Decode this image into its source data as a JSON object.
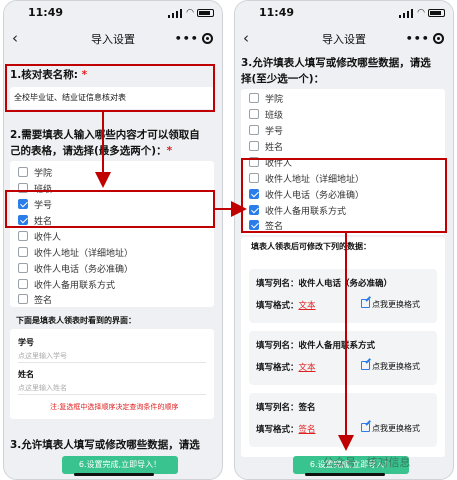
{
  "status": {
    "time": "11:49"
  },
  "nav": {
    "title": "导入设置",
    "dots": "•••"
  },
  "left": {
    "q1": {
      "label": "1.核对表名称:",
      "required": "*"
    },
    "table_name": "全校毕业证、结业证信息核对表",
    "q2": {
      "line1": "2.需要填表人输入哪些内容才可以领取自",
      "line2": "己的表格，请选择(最多选两个)：",
      "required": "*"
    },
    "options": [
      {
        "label": "学院",
        "checked": false
      },
      {
        "label": "班级",
        "checked": false
      },
      {
        "label": "学号",
        "checked": true
      },
      {
        "label": "姓名",
        "checked": true
      },
      {
        "label": "收件人",
        "checked": false
      },
      {
        "label": "收件人地址（详细地址）",
        "checked": false
      },
      {
        "label": "收件人电话（务必准确）",
        "checked": false
      },
      {
        "label": "收件人备用联系方式",
        "checked": false
      },
      {
        "label": "签名",
        "checked": false
      }
    ],
    "preview": {
      "title": "下面是填表人领表时看到的界面：",
      "field1_label": "学号",
      "field1_placeholder": "点这里输入学号",
      "field2_label": "姓名",
      "field2_placeholder": "点这里输入姓名",
      "note": "注:复选框中选择顺序决定查询条件的顺序"
    },
    "q3": {
      "line1": "3.允许填表人填写或修改哪些数据，请选"
    },
    "button": "6.设置完成,立即导入！"
  },
  "right": {
    "q3": {
      "line1": "3.允许填表人填写或修改哪些数据，请选",
      "line2": "择(至少选一个)："
    },
    "options": [
      {
        "label": "学院",
        "checked": false
      },
      {
        "label": "班级",
        "checked": false
      },
      {
        "label": "学号",
        "checked": false
      },
      {
        "label": "姓名",
        "checked": false
      },
      {
        "label": "收件人",
        "checked": false
      },
      {
        "label": "收件人地址（详细地址）",
        "checked": false
      },
      {
        "label": "收件人电话（务必准确）",
        "checked": true
      },
      {
        "label": "收件人备用联系方式",
        "checked": true
      },
      {
        "label": "签名",
        "checked": true
      }
    ],
    "editable_title": "填表人领表后可修改下列的数据：",
    "items": [
      {
        "col_prefix": "填写列名：",
        "col_name": "收件人电话（务必准确）",
        "fmt_prefix": "填写格式：",
        "fmt": "文本",
        "change": "点我更换格式"
      },
      {
        "col_prefix": "填写列名：",
        "col_name": "收件人备用联系方式",
        "fmt_prefix": "填写格式：",
        "fmt": "文本",
        "change": "点我更换格式"
      },
      {
        "col_prefix": "填写列名：",
        "col_name": "签名",
        "fmt_prefix": "填写格式：",
        "fmt": "签名",
        "change": "点我更换格式"
      }
    ],
    "button": "6.设置完成,立即导入！",
    "watermark": "公众号 · 核对信息"
  },
  "colors": {
    "highlight": "#c00000",
    "accent": "#2b7de9",
    "button": "#39c38e",
    "required": "#e02020"
  }
}
